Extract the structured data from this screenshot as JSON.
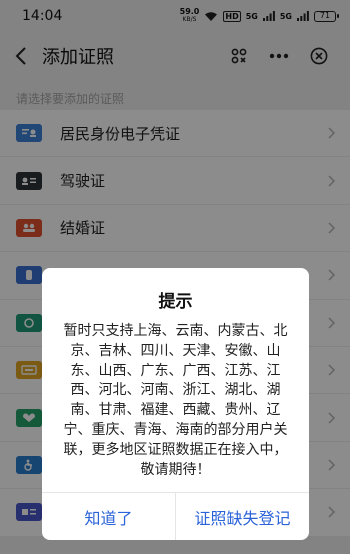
{
  "status_bar": {
    "time": "14:04",
    "net_speed": "59.0",
    "net_speed_unit": "KB/S",
    "hd": "HD",
    "signal_label": "5G",
    "signal_label_2": "5G",
    "battery": "71"
  },
  "nav": {
    "title": "添加证照"
  },
  "section_hint": "请选择要添加的证照",
  "certificates": [
    {
      "label": "居民身份电子凭证",
      "icon": "id-card-icon",
      "color": "#3b82d6"
    },
    {
      "label": "驾驶证",
      "icon": "driver-license-icon",
      "color": "#2f3338"
    },
    {
      "label": "结婚证",
      "icon": "marriage-certificate-icon",
      "color": "#e0522e"
    },
    {
      "label": "",
      "icon": "certificate-icon",
      "color": "#3a6fcf"
    },
    {
      "label": "",
      "icon": "certificate-icon",
      "color": "#1f9a77"
    },
    {
      "label": "",
      "icon": "certificate-icon",
      "color": "#e0a526"
    },
    {
      "label": "",
      "icon": "certificate-icon",
      "color": "#23a36b"
    },
    {
      "label": "",
      "icon": "accessibility-icon",
      "color": "#2b7fd0"
    },
    {
      "label": "",
      "icon": "certificate-icon",
      "color": "#4a57c9"
    }
  ],
  "dialog": {
    "title": "提示",
    "lines": [
      "暂时只支持上海、云南、内蒙古、北",
      "京、吉林、四川、天津、安徽、山",
      "东、山西、广东、广西、江苏、江",
      "西、河北、河南、浙江、湖北、湖",
      "南、甘肃、福建、西藏、贵州、辽",
      "宁、重庆、青海、海南的部分用户关",
      "联，更多地区证照数据正在接入中，",
      "敬请期待！"
    ],
    "btn_ok": "知道了",
    "btn_register": "证照缺失登记"
  },
  "colors": {
    "accent": "#2b63d9",
    "overlay": "rgba(0,0,0,0.45)"
  }
}
